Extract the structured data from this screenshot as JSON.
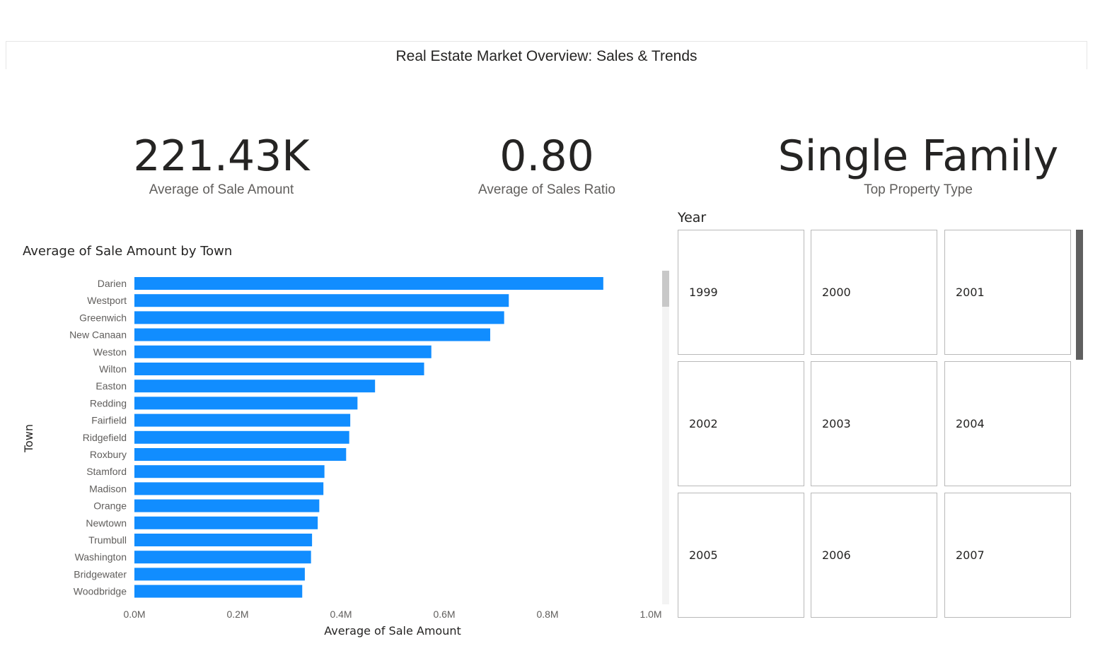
{
  "report": {
    "title": "Real Estate Market Overview: Sales & Trends"
  },
  "kpis": [
    {
      "value": "221.43K",
      "label": "Average of Sale Amount"
    },
    {
      "value": "0.80",
      "label": "Average of Sales Ratio"
    },
    {
      "value": "Single Family",
      "label": "Top Property Type"
    }
  ],
  "chart_data": {
    "type": "bar",
    "orientation": "horizontal",
    "title": "Average of Sale Amount by Town",
    "xlabel": "Average of Sale Amount",
    "ylabel": "Town",
    "xlim": [
      0,
      1000000
    ],
    "xticks": [
      "0.0M",
      "0.2M",
      "0.4M",
      "0.6M",
      "0.8M",
      "1.0M"
    ],
    "categories": [
      "Darien",
      "Westport",
      "Greenwich",
      "New Canaan",
      "Weston",
      "Wilton",
      "Easton",
      "Redding",
      "Fairfield",
      "Ridgefield",
      "Roxbury",
      "Stamford",
      "Madison",
      "Orange",
      "Newtown",
      "Trumbull",
      "Washington",
      "Bridgewater",
      "Woodbridge"
    ],
    "values": [
      908000,
      725000,
      716000,
      689000,
      575000,
      561000,
      466000,
      432000,
      418000,
      416000,
      410000,
      368000,
      366000,
      358000,
      355000,
      344000,
      342000,
      330000,
      325000
    ],
    "grid": false,
    "color": "#118dff"
  },
  "slicer": {
    "header": "Year",
    "options": [
      "1999",
      "2000",
      "2001",
      "2002",
      "2003",
      "2004",
      "2005",
      "2006",
      "2007"
    ]
  }
}
